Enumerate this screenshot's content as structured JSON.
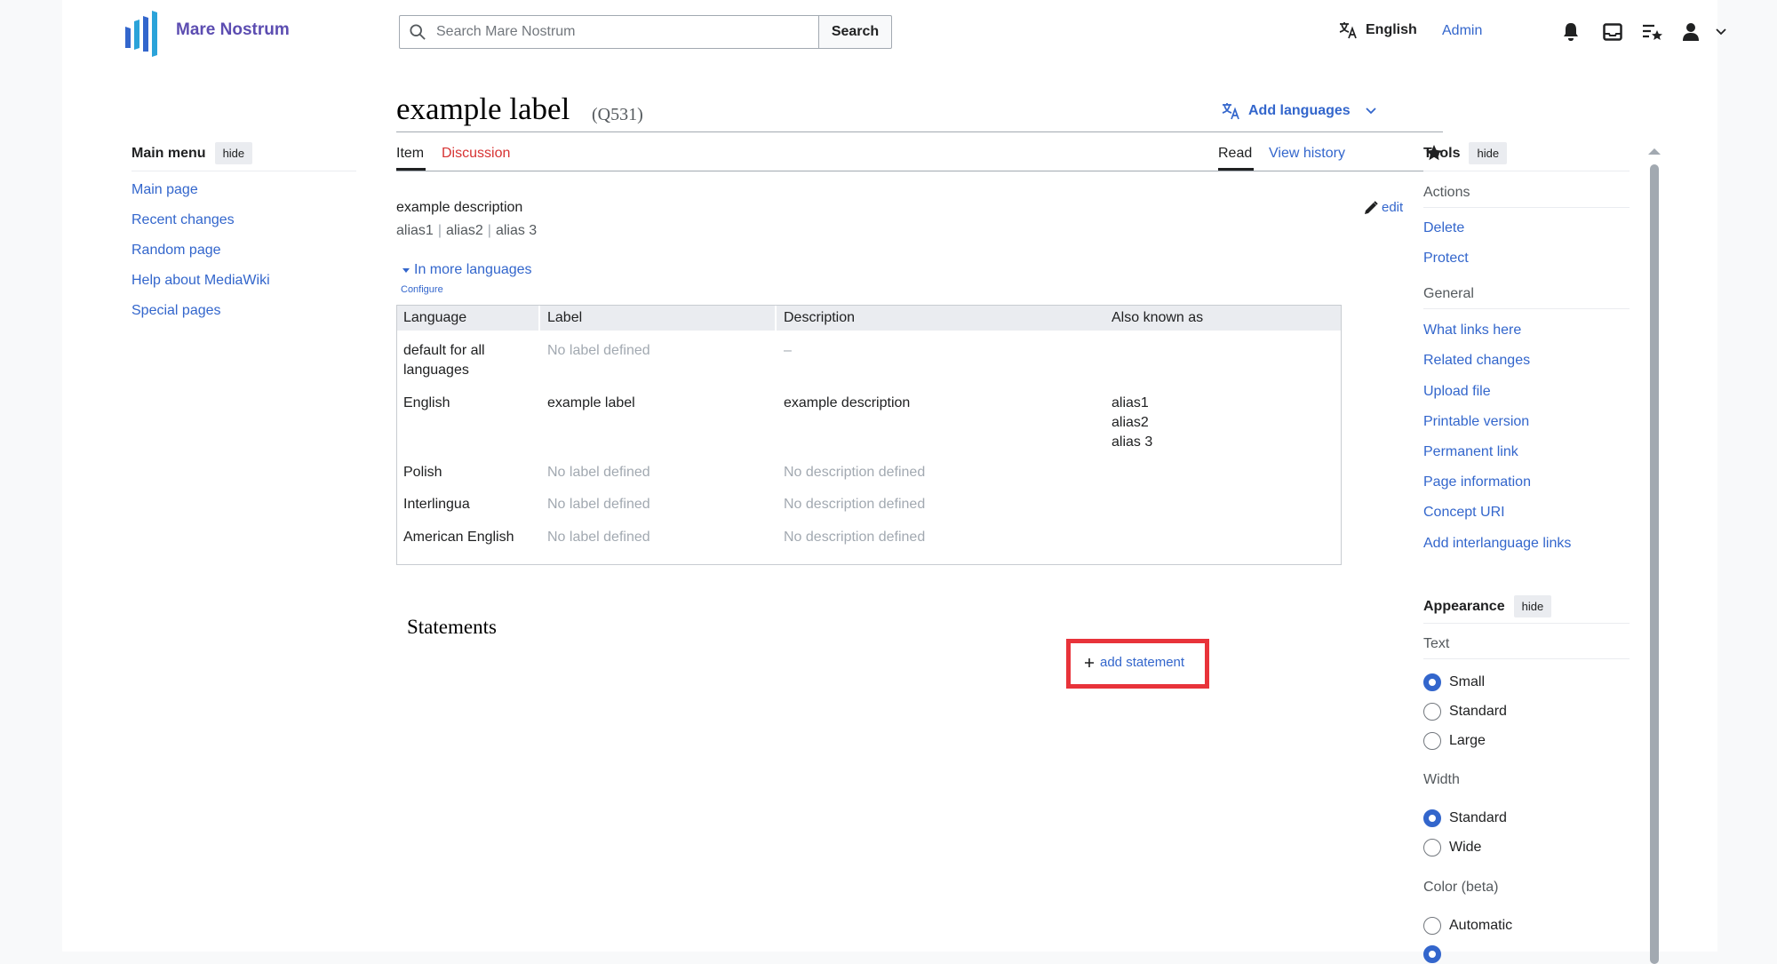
{
  "header": {
    "site_name": "Mare Nostrum",
    "search_placeholder": "Search Mare Nostrum",
    "search_button": "Search",
    "language": "English",
    "user": "Admin"
  },
  "main_menu": {
    "title": "Main menu",
    "hide_label": "hide",
    "items": [
      "Main page",
      "Recent changes",
      "Random page",
      "Help about MediaWiki",
      "Special pages"
    ]
  },
  "item": {
    "label": "example label",
    "id": "(Q531)",
    "add_languages": "Add languages",
    "tabs": {
      "item": "Item",
      "discussion": "Discussion",
      "read": "Read",
      "view_history": "View history"
    },
    "description": "example description",
    "aliases": [
      "alias1",
      "alias2",
      "alias 3"
    ],
    "edit_label": "edit",
    "more_languages": "In more languages",
    "configure": "Configure"
  },
  "languages_table": {
    "headers": [
      "Language",
      "Label",
      "Description",
      "Also known as"
    ],
    "rows": [
      {
        "language": "default for all languages",
        "label": "No label defined",
        "description": "–",
        "aliases": []
      },
      {
        "language": "English",
        "label": "example label",
        "description": "example description",
        "aliases": [
          "alias1",
          "alias2",
          "alias 3"
        ]
      },
      {
        "language": "Polish",
        "label": "No label defined",
        "description": "No description defined",
        "aliases": []
      },
      {
        "language": "Interlingua",
        "label": "No label defined",
        "description": "No description defined",
        "aliases": []
      },
      {
        "language": "American English",
        "label": "No label defined",
        "description": "No description defined",
        "aliases": []
      }
    ]
  },
  "statements": {
    "heading": "Statements",
    "add_label": "add statement"
  },
  "tools": {
    "title": "Tools",
    "hide_label": "hide",
    "actions_heading": "Actions",
    "actions": [
      "Delete",
      "Protect"
    ],
    "general_heading": "General",
    "general": [
      "What links here",
      "Related changes",
      "Upload file",
      "Printable version",
      "Permanent link",
      "Page information",
      "Concept URI",
      "Add interlanguage links"
    ]
  },
  "appearance": {
    "title": "Appearance",
    "hide_label": "hide",
    "text_heading": "Text",
    "text_options": [
      "Small",
      "Standard",
      "Large"
    ],
    "text_selected": "Small",
    "width_heading": "Width",
    "width_options": [
      "Standard",
      "Wide"
    ],
    "width_selected": "Standard",
    "color_heading": "Color (beta)",
    "color_options": [
      "Automatic"
    ]
  },
  "colors": {
    "link": "#3366cc",
    "red_link": "#d73333",
    "highlight": "#e8333a",
    "brand": "#5c4db1"
  }
}
